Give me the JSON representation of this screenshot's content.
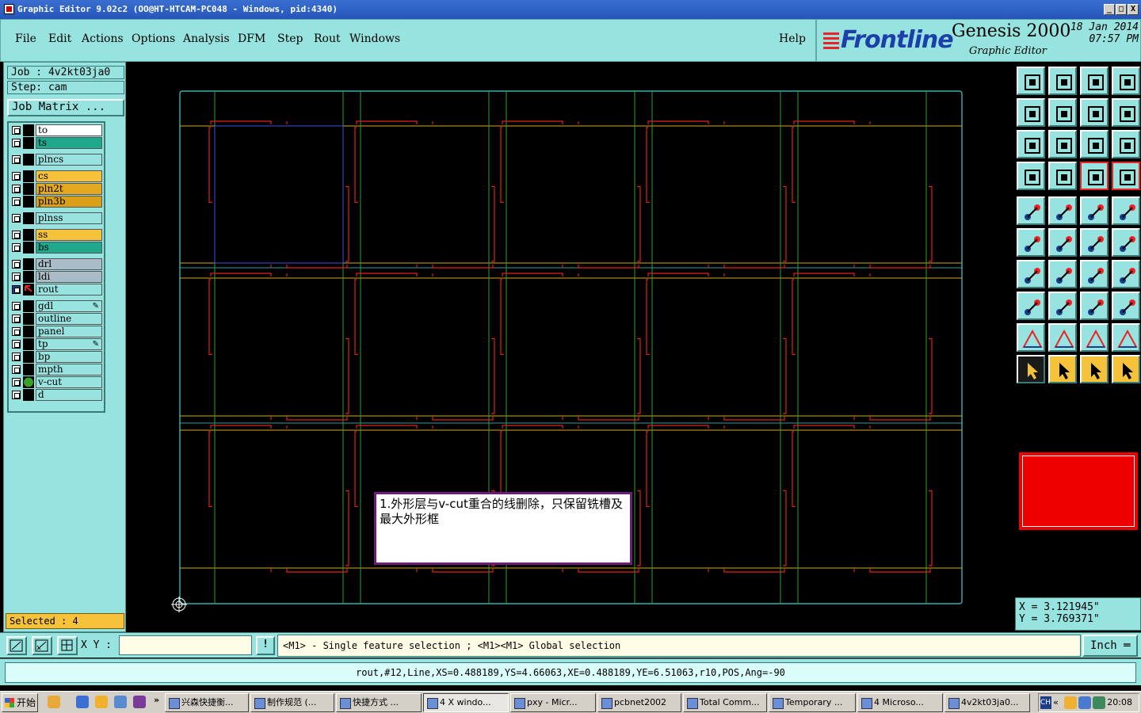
{
  "window": {
    "title": "Graphic Editor 9.02c2 (OO@HT-HTCAM-PC048 - Windows, pid:4340)",
    "controls": [
      "_",
      "□",
      "X"
    ]
  },
  "menu": {
    "items": [
      "File",
      "Edit",
      "Actions",
      "Options",
      "Analysis",
      "DFM",
      "Step",
      "Rout",
      "Windows"
    ],
    "help": "Help"
  },
  "brand": {
    "logo": "Frontline",
    "product": "Genesis 2000",
    "subtitle": "Graphic Editor",
    "date": "18 Jan 2014",
    "time": "07:57 PM"
  },
  "job": {
    "job_label": "Job : 4v2kt03ja0",
    "step_label": "Step: cam",
    "matrix_button": "Job Matrix ..."
  },
  "layers": [
    {
      "name": "to",
      "color": "#ffffff"
    },
    {
      "name": "ts",
      "color": "#1fa88c"
    },
    {
      "name": "plncs",
      "color": "#97e3e0"
    },
    {
      "name": "cs",
      "color": "#f6c23a"
    },
    {
      "name": "pln2t",
      "color": "#e3a81e"
    },
    {
      "name": "pln3b",
      "color": "#d9a018"
    },
    {
      "name": "plnss",
      "color": "#97e3e0"
    },
    {
      "name": "ss",
      "color": "#f6c23a"
    },
    {
      "name": "bs",
      "color": "#1fa88c"
    },
    {
      "name": "drl",
      "color": "#a9bcc8"
    },
    {
      "name": "ldi",
      "color": "#a9bcc8"
    },
    {
      "name": "rout",
      "color": "#97e3e0"
    },
    {
      "name": "gdl",
      "color": "#97e3e0"
    },
    {
      "name": "outline",
      "color": "#97e3e0"
    },
    {
      "name": "panel",
      "color": "#97e3e0"
    },
    {
      "name": "tp",
      "color": "#97e3e0"
    },
    {
      "name": "bp",
      "color": "#97e3e0"
    },
    {
      "name": "mpth",
      "color": "#97e3e0"
    },
    {
      "name": "v-cut",
      "color": "#97e3e0"
    },
    {
      "name": "d",
      "color": "#97e3e0"
    }
  ],
  "selected": "Selected : 4",
  "memo": "1.外形层与v-cut重合的线删除，只保留铣槽及最大外形框",
  "coords": {
    "x": "X = 3.121945\"",
    "y": "Y = 3.769371\""
  },
  "command": {
    "xy_label": "X Y :",
    "xy_value": "",
    "excl": "!",
    "message": "<M1> - Single feature selection ; <M1><M1> Global selection",
    "unit": "Inch"
  },
  "feature_info": "rout,#12,Line,XS=0.488189,YS=4.66063,XE=0.488189,YE=6.51063,r10,POS,Ang=-90",
  "taskbar": {
    "start": "开始",
    "tasks": [
      "兴森快捷衡...",
      "制作规范 (...",
      "快捷方式 ...",
      "4 X windo...",
      "pxy - Micr...",
      "pcbnet2002",
      "Total Comm...",
      "Temporary ...",
      "4 Microso...",
      "4v2kt03ja0..."
    ],
    "clock": "20:08",
    "ch": "CH"
  },
  "colors": {
    "panel": "#97e3e0",
    "rout": "#e02020",
    "vcut_h": "#d4a81e",
    "vcut_v": "#2fa02f",
    "frame": "#3fd0d0",
    "highlight": "#3a50e0"
  }
}
